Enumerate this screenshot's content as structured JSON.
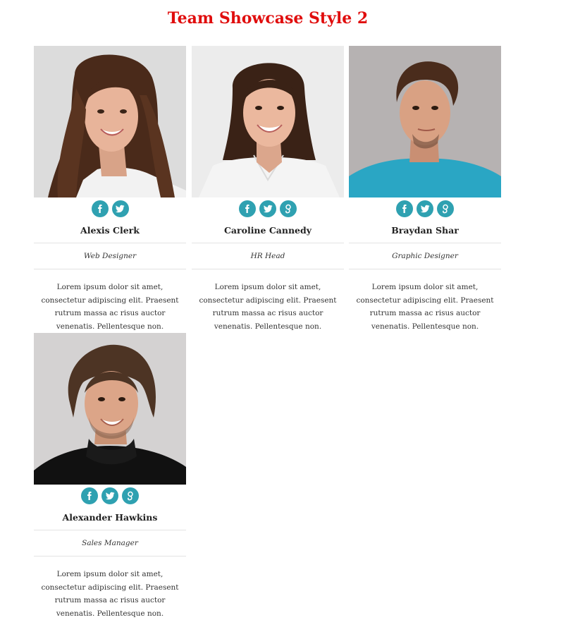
{
  "page": {
    "title": "Team Showcase Style 2"
  },
  "accent_color": "#2fa1b1",
  "title_color": "#e00d0d",
  "members": [
    {
      "name": "Alexis Clerk",
      "role": "Web Designer",
      "description": "Lorem ipsum dolor sit amet, consectetur adipiscing elit. Praesent rutrum massa ac risus auctor venenatis. Pellentesque non.",
      "social": [
        "facebook-icon",
        "twitter-icon"
      ]
    },
    {
      "name": "Caroline Cannedy",
      "role": "HR Head",
      "description": "Lorem ipsum dolor sit amet, consectetur adipiscing elit. Praesent rutrum massa ac risus auctor venenatis. Pellentesque non.",
      "social": [
        "facebook-icon",
        "twitter-icon",
        "google-plus-icon"
      ]
    },
    {
      "name": "Braydan Shar",
      "role": "Graphic Designer",
      "description": "Lorem ipsum dolor sit amet, consectetur adipiscing elit. Praesent rutrum massa ac risus auctor venenatis. Pellentesque non.",
      "social": [
        "facebook-icon",
        "twitter-icon",
        "google-plus-icon"
      ]
    },
    {
      "name": "Alexander Hawkins",
      "role": "Sales Manager",
      "description": "Lorem ipsum dolor sit amet, consectetur adipiscing elit. Praesent rutrum massa ac risus auctor venenatis. Pellentesque non.",
      "social": [
        "facebook-icon",
        "twitter-icon",
        "google-plus-icon"
      ]
    }
  ]
}
